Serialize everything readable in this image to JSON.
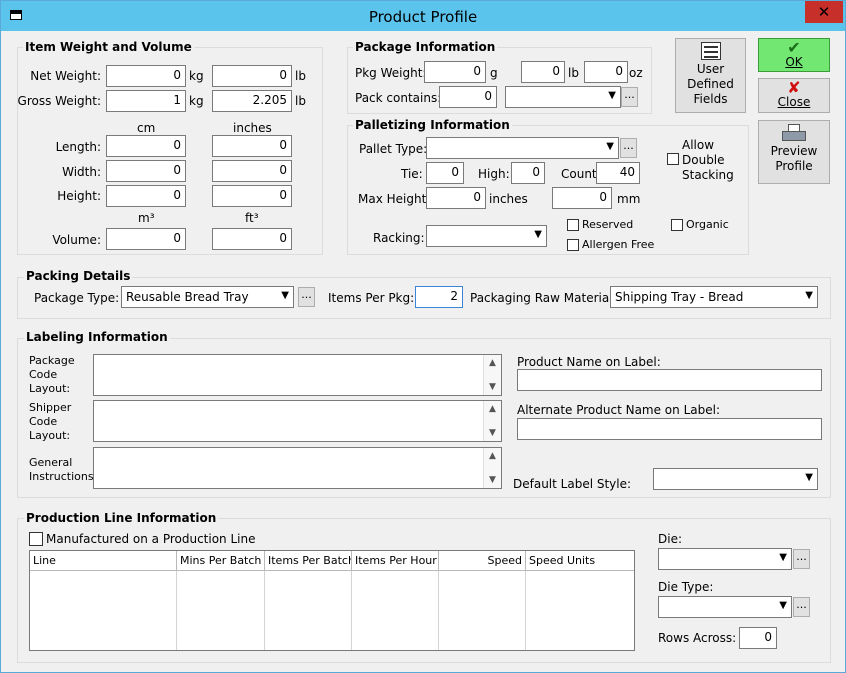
{
  "window": {
    "title": "Product Profile"
  },
  "weight_volume": {
    "title": "Item Weight and Volume",
    "net_weight_label": "Net Weight:",
    "net_weight_kg": "0",
    "net_weight_lb": "0",
    "gross_weight_label": "Gross Weight:",
    "gross_weight_kg": "1",
    "gross_weight_lb": "2.205",
    "kg_unit": "kg",
    "lb_unit": "lb",
    "cm_label": "cm",
    "inches_label": "inches",
    "length_label": "Length:",
    "length_cm": "0",
    "length_in": "0",
    "width_label": "Width:",
    "width_cm": "0",
    "width_in": "0",
    "height_label": "Height:",
    "height_cm": "0",
    "height_in": "0",
    "m3_label": "m³",
    "ft3_label": "ft³",
    "volume_label": "Volume:",
    "volume_m3": "0",
    "volume_ft3": "0"
  },
  "package": {
    "title": "Package Information",
    "pkg_weight_label": "Pkg Weight:",
    "pkg_weight_g": "0",
    "g_unit": "g",
    "pkg_weight_lb": "0",
    "lb_unit": "lb",
    "pkg_weight_oz": "0",
    "oz_unit": "oz",
    "pack_contains_label": "Pack contains:",
    "pack_contains_value": "0",
    "pack_contains_select": ""
  },
  "palletizing": {
    "title": "Palletizing Information",
    "pallet_type_label": "Pallet Type:",
    "pallet_type_value": "",
    "tie_label": "Tie:",
    "tie_value": "0",
    "high_label": "High:",
    "high_value": "0",
    "count_label": "Count:",
    "count_value": "40",
    "max_height_label": "Max Height:",
    "max_height_in": "0",
    "inches_unit": "inches",
    "max_height_mm": "0",
    "mm_unit": "mm",
    "racking_label": "Racking:",
    "racking_value": "",
    "allow_double_stacking": "Allow\nDouble\nStacking",
    "reserved_label": "Reserved",
    "organic_label": "Organic",
    "allergen_free_label": "Allergen Free"
  },
  "buttons": {
    "user_defined_fields": "User\nDefined\nFields",
    "ok": "OK",
    "close": "Close",
    "preview_profile": "Preview\nProfile"
  },
  "packing": {
    "title": "Packing Details",
    "package_type_label": "Package Type:",
    "package_type_value": "Reusable Bread Tray",
    "items_per_pkg_label": "Items Per Pkg:",
    "items_per_pkg_value": "2",
    "raw_material_label": "Packaging Raw Material:",
    "raw_material_value": "Shipping Tray - Bread"
  },
  "labeling": {
    "title": "Labeling Information",
    "package_code_layout_label": "Package\nCode\nLayout:",
    "shipper_code_layout_label": "Shipper\nCode\nLayout:",
    "general_instructions_label": "General\nInstructions:",
    "product_name_label": "Product Name on Label:",
    "product_name_value": "",
    "alt_product_name_label": "Alternate Product Name on Label:",
    "alt_product_name_value": "",
    "default_label_style_label": "Default Label Style:",
    "default_label_style_value": ""
  },
  "production": {
    "title": "Production Line Information",
    "manufactured_label": "Manufactured on a Production Line",
    "columns": [
      "Line",
      "Mins Per Batch",
      "Items Per Batch",
      "Items Per Hour",
      "Speed",
      "Speed Units"
    ],
    "die_label": "Die:",
    "die_value": "",
    "die_type_label": "Die Type:",
    "die_type_value": "",
    "rows_across_label": "Rows Across:",
    "rows_across_value": "0"
  },
  "colors": {
    "titlebar": "#5bc4ed",
    "close_button": "#c7302a",
    "ok_button": "#72e872"
  }
}
